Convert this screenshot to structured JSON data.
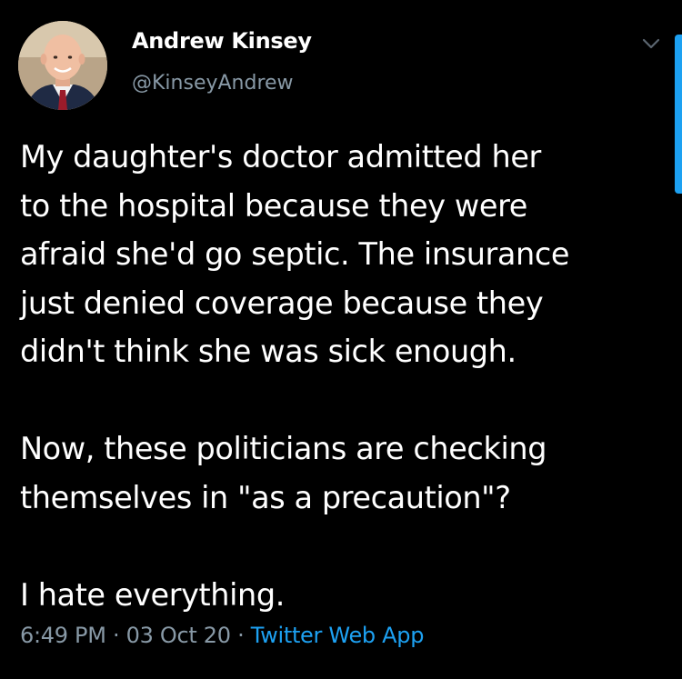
{
  "author": {
    "name": "Andrew Kinsey",
    "handle": "@KinseyAndrew"
  },
  "tweet": {
    "paragraphs": [
      [
        "My daughter's doctor admitted her",
        "to the hospital because they were",
        "afraid she'd go septic.  The insurance",
        "just denied coverage because they",
        "didn't think she was sick enough."
      ],
      [
        "Now, these politicians are checking",
        "themselves in \"as a precaution\"?"
      ],
      [
        "I hate everything."
      ]
    ]
  },
  "meta": {
    "time": "6:49 PM",
    "separator": " · ",
    "date": "03 Oct 20",
    "source": "Twitter Web App"
  },
  "icons": {
    "menu": "chevron-down-icon",
    "avatar": "avatar"
  },
  "colors": {
    "background": "#000000",
    "text": "#ffffff",
    "secondary": "#8899a6",
    "accent": "#1da1f2"
  }
}
